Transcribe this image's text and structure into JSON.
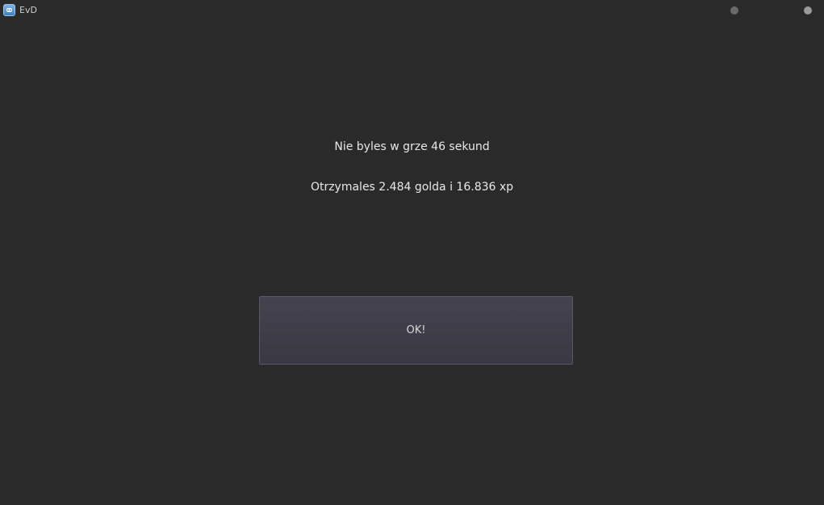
{
  "window": {
    "title": "EvD",
    "app_icon": "game-controller-icon"
  },
  "message": {
    "line1": "Nie byles w grze 46 sekund",
    "line2": "Otrzymales 2.484 golda i 16.836 xp"
  },
  "dialog": {
    "ok_label": "OK!"
  },
  "colors": {
    "background": "#2a2a2a",
    "text": "#e8e8e8",
    "button": "#403e49"
  }
}
